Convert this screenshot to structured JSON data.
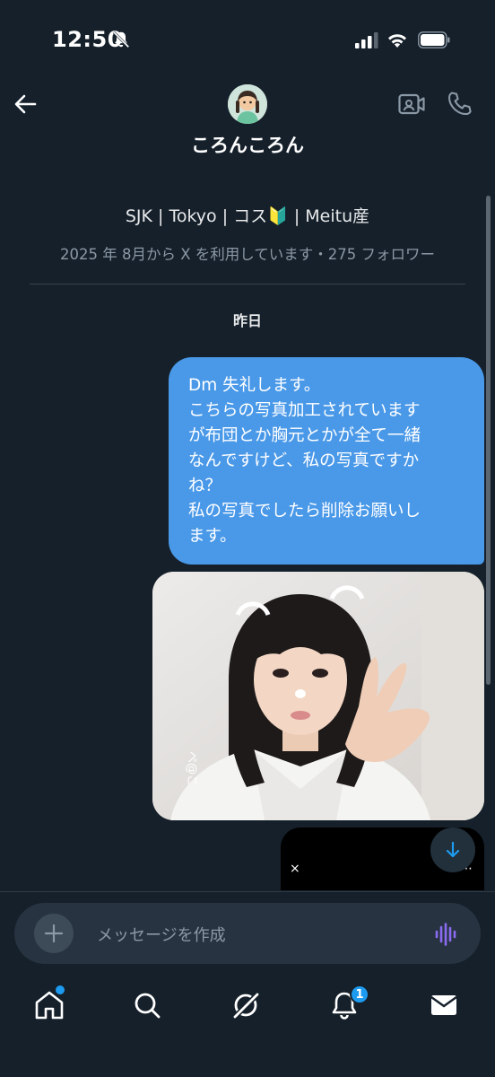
{
  "status_bar": {
    "time": "12:50",
    "icons": [
      "bell-off-icon",
      "cellular-signal-icon",
      "wifi-icon",
      "battery-icon"
    ]
  },
  "header": {
    "contact_name": "ころんころん",
    "icons": [
      "back-arrow-icon",
      "avatar",
      "video-call-icon",
      "phone-call-icon"
    ]
  },
  "profile": {
    "bio": "SJK | Tokyo | コス🔰 | Meitu産",
    "meta": "2025 年 8月から X を利用しています・275 フォロワー"
  },
  "conversation": {
    "day_label": "昨日",
    "messages": [
      {
        "type": "text",
        "lines": [
          "Dm 失礼します。",
          "こちらの写真加工されています",
          "が布団とか胸元とかが全て一緒",
          "なんですけど、私の写真ですか",
          "ね？",
          "私の写真でしたら削除お願いし",
          "ます。"
        ]
      },
      {
        "type": "photo",
        "watermark": "ぺ@こ"
      },
      {
        "type": "video",
        "close_glyph": "×",
        "more_glyph": "⋯"
      }
    ]
  },
  "composer": {
    "placeholder": "メッセージを作成"
  },
  "bottom_nav": {
    "items": [
      "home-icon",
      "search-icon",
      "grok-icon",
      "notifications-icon",
      "messages-icon"
    ],
    "notification_count": "1"
  },
  "colors": {
    "background": "#15202b",
    "bubble": "#4a99e9",
    "accent": "#1d9bf0",
    "voice": "#8b6cf0"
  }
}
